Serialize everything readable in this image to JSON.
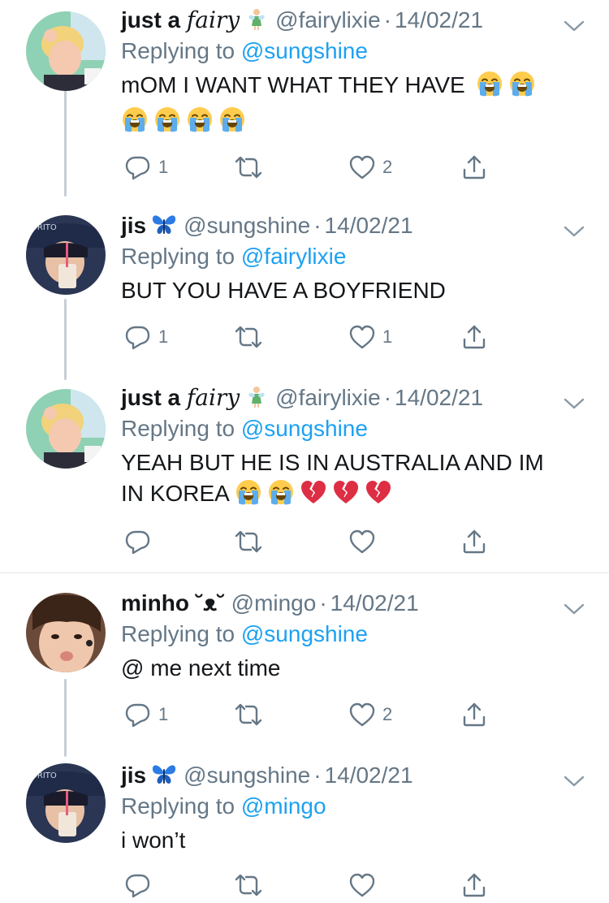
{
  "tweets": [
    {
      "name_plain": "just a ",
      "name_fancy": "fairy",
      "name_emoji": "fairy",
      "handle": "@fairylixie",
      "date": "14/02/21",
      "replying_prefix": "Replying to ",
      "replying_to": "@sungshine",
      "text": "mOM I WANT WHAT THEY HAVE",
      "text_line2": "",
      "replies": "1",
      "retweets": "",
      "likes": "2"
    },
    {
      "name_plain": "jis",
      "name_fancy": "",
      "name_emoji": "butterfly",
      "handle": "@sungshine",
      "date": "14/02/21",
      "replying_prefix": "Replying to ",
      "replying_to": "@fairylixie",
      "text": "BUT YOU HAVE A BOYFRIEND",
      "replies": "1",
      "retweets": "",
      "likes": "1"
    },
    {
      "name_plain": "just a ",
      "name_fancy": "fairy",
      "name_emoji": "fairy",
      "handle": "@fairylixie",
      "date": "14/02/21",
      "replying_prefix": "Replying to ",
      "replying_to": "@sungshine",
      "text": "YEAH BUT HE IS IN AUSTRALIA AND IM",
      "text_line2": "IN KOREA",
      "replies": "",
      "retweets": "",
      "likes": ""
    },
    {
      "name_plain": "minho ",
      "name_fancy": "˘ᴥ˘",
      "name_emoji": "",
      "handle": "@mingo",
      "date": "14/02/21",
      "replying_prefix": "Replying to ",
      "replying_to": "@sungshine",
      "text": "@ me next time",
      "replies": "1",
      "retweets": "",
      "likes": "2"
    },
    {
      "name_plain": "jis",
      "name_fancy": "",
      "name_emoji": "butterfly",
      "handle": "@sungshine",
      "date": "14/02/21",
      "replying_prefix": "Replying to ",
      "replying_to": "@mingo",
      "text": "i won’t",
      "replies": "",
      "retweets": "",
      "likes": ""
    }
  ],
  "separator_dot": "·",
  "colors": {
    "link": "#1da1f2",
    "muted": "#657786",
    "thread_line": "#c4cfd6",
    "divider": "#e1e8ed"
  },
  "icons": [
    "reply-icon",
    "retweet-icon",
    "like-icon",
    "share-icon",
    "chevron-down-icon",
    "loudly-crying-face-icon",
    "broken-heart-icon",
    "fairy-icon",
    "butterfly-icon"
  ]
}
